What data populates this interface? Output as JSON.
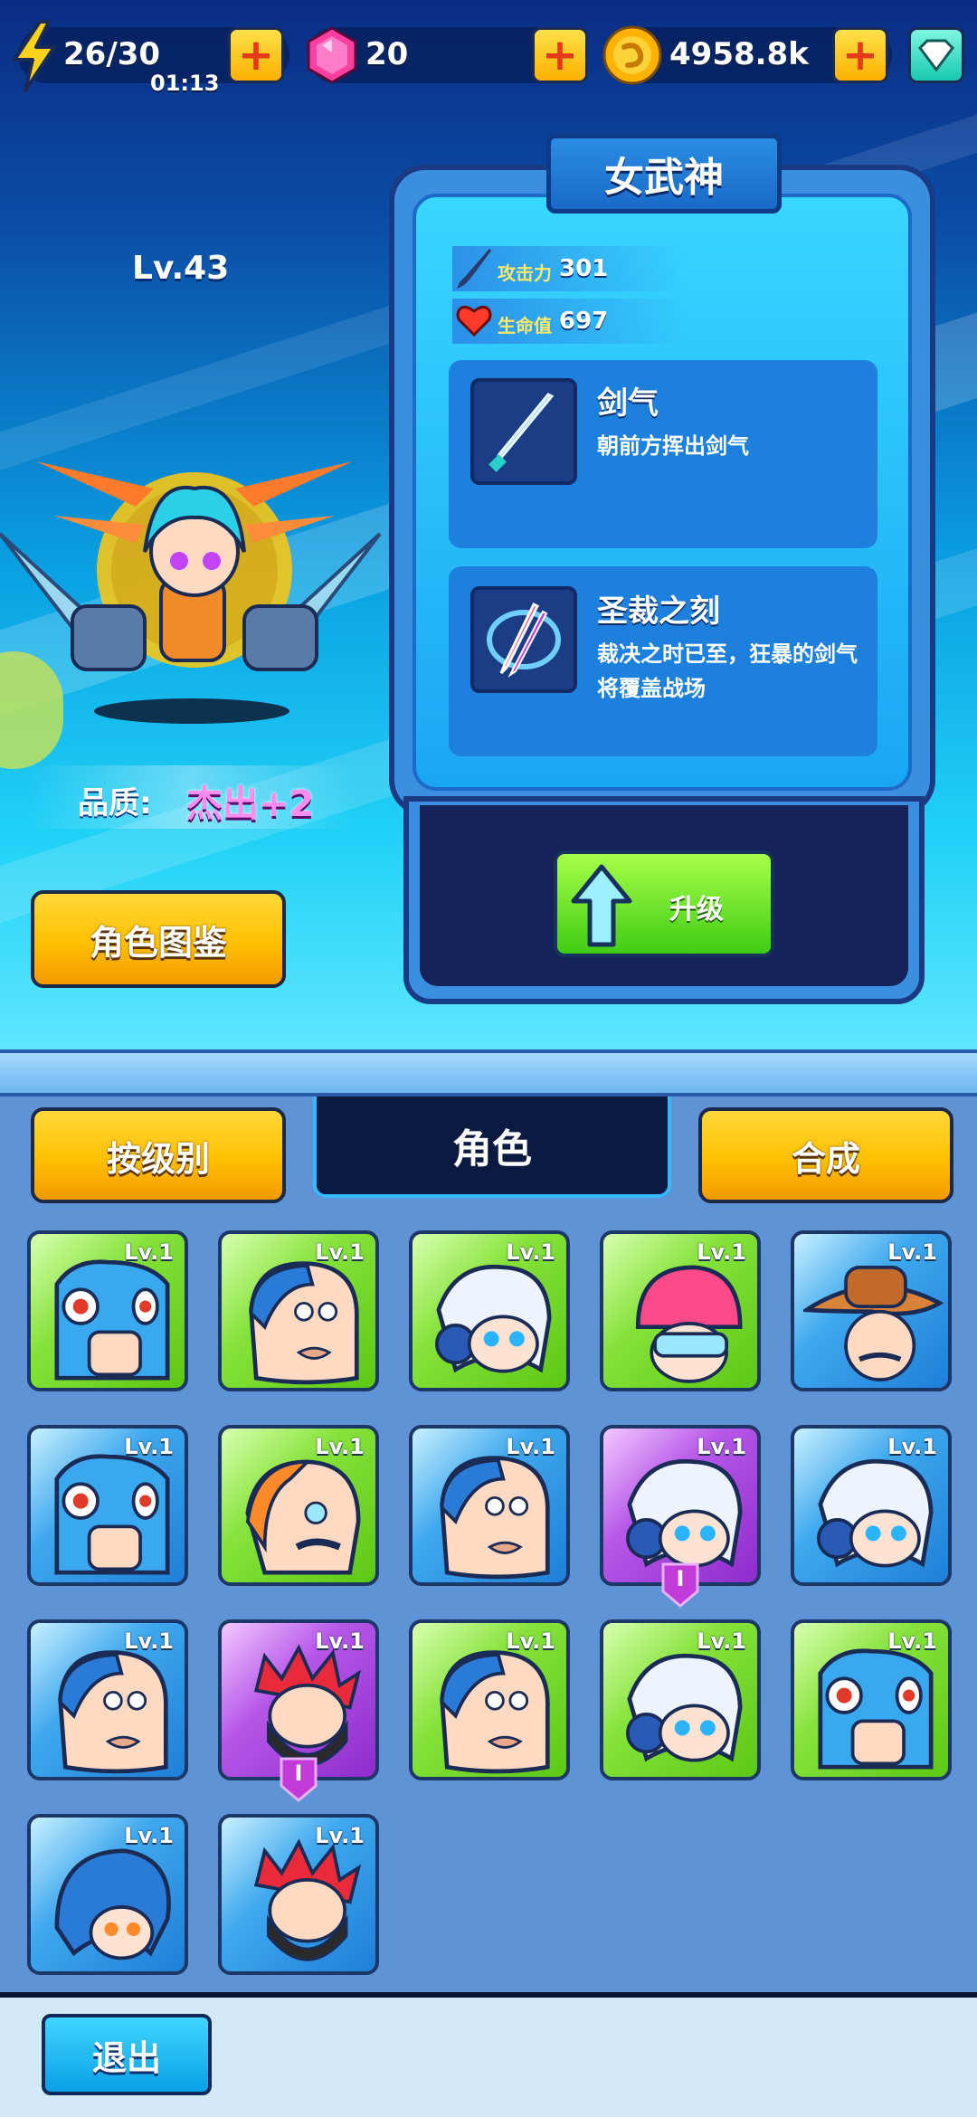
{
  "topbar": {
    "energy": "26/30",
    "energy_timer": "01:13",
    "gems": "20",
    "coins": "4958.8k"
  },
  "hero": {
    "level": "Lv.43",
    "quality_label": "品质:",
    "quality_value": "杰出+2",
    "codex_button": "角色图鉴"
  },
  "panel": {
    "title": "女武神",
    "stats": [
      {
        "label": "攻击力",
        "value": "301"
      },
      {
        "label": "生命值",
        "value": "697"
      }
    ],
    "skills": [
      {
        "name": "剑气",
        "desc": "朝前方挥出剑气"
      },
      {
        "name": "圣裁之刻",
        "desc": "裁决之时已至，狂暴的剑气将覆盖战场"
      }
    ],
    "upgrade_button": "升级"
  },
  "tabs": {
    "by_level": "按级别",
    "characters": "角色",
    "merge": "合成"
  },
  "roster": [
    {
      "lv": "Lv.1",
      "color": "green",
      "face": "fish"
    },
    {
      "lv": "Lv.1",
      "color": "green",
      "face": "man"
    },
    {
      "lv": "Lv.1",
      "color": "green",
      "face": "girl"
    },
    {
      "lv": "Lv.1",
      "color": "green",
      "face": "pinkgirl"
    },
    {
      "lv": "Lv.1",
      "color": "blue",
      "face": "cowboy"
    },
    {
      "lv": "Lv.1",
      "color": "blue",
      "face": "fish"
    },
    {
      "lv": "Lv.1",
      "color": "green",
      "face": "villain"
    },
    {
      "lv": "Lv.1",
      "color": "blue",
      "face": "man"
    },
    {
      "lv": "Lv.1",
      "color": "purple",
      "face": "girl",
      "rank": "I"
    },
    {
      "lv": "Lv.1",
      "color": "blue",
      "face": "girl"
    },
    {
      "lv": "Lv.1",
      "color": "blue",
      "face": "man"
    },
    {
      "lv": "Lv.1",
      "color": "purple",
      "face": "beard",
      "rank": "I"
    },
    {
      "lv": "Lv.1",
      "color": "green",
      "face": "man"
    },
    {
      "lv": "Lv.1",
      "color": "green",
      "face": "girl"
    },
    {
      "lv": "Lv.1",
      "color": "green",
      "face": "fish"
    },
    {
      "lv": "Lv.1",
      "color": "blue",
      "face": "bluegirl"
    },
    {
      "lv": "Lv.1",
      "color": "blue",
      "face": "beard"
    }
  ],
  "footer": {
    "exit_button": "退出"
  }
}
